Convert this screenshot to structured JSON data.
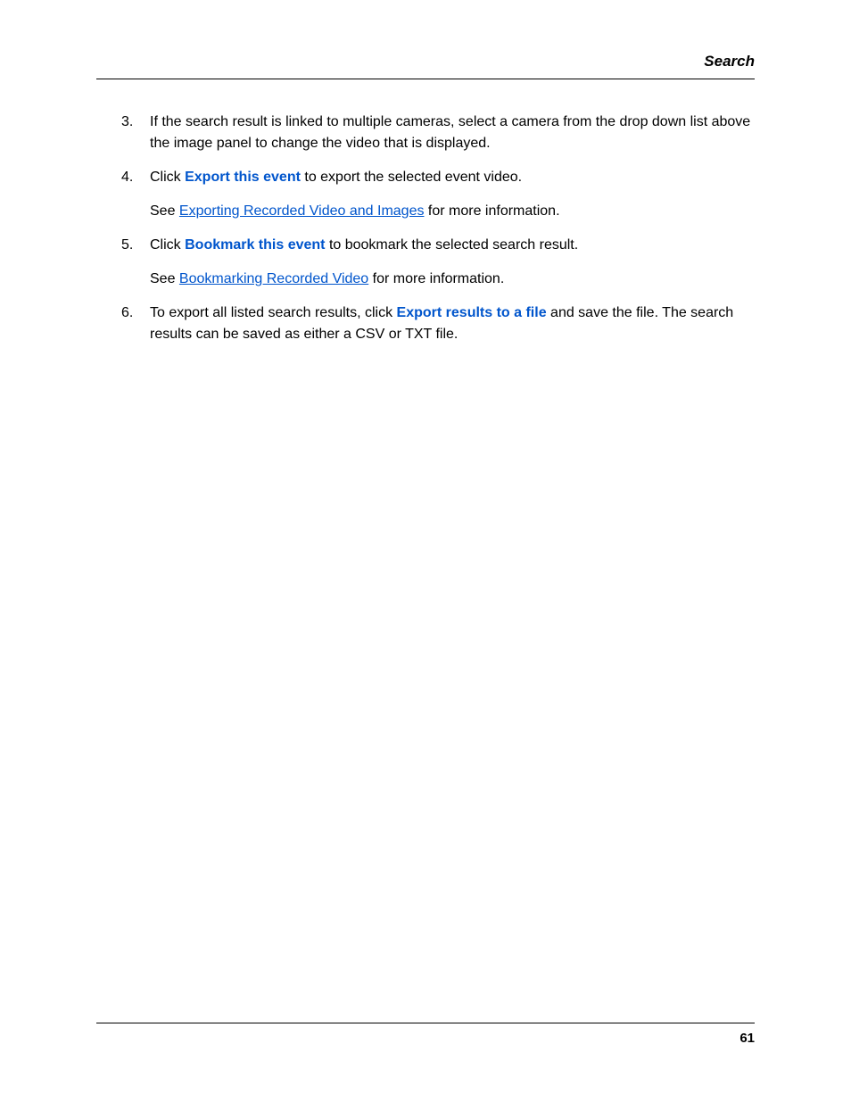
{
  "header": {
    "title": "Search"
  },
  "steps": {
    "s3": {
      "num": "3.",
      "text": "If the search result is linked to multiple cameras, select a camera from the drop down list above the image panel to change the video that is displayed."
    },
    "s4": {
      "num": "4.",
      "pre": "Click ",
      "bold": "Export this event",
      "post": " to export the selected event video.",
      "see_pre": "See ",
      "see_link": "Exporting Recorded Video and Images",
      "see_post": " for more information."
    },
    "s5": {
      "num": "5.",
      "pre": "Click ",
      "bold": "Bookmark this event",
      "post": " to bookmark the selected search result.",
      "see_pre": "See ",
      "see_link": "Bookmarking Recorded Video",
      "see_post": " for more information."
    },
    "s6": {
      "num": "6.",
      "pre": "To export all listed search results, click ",
      "bold": "Export results to a file",
      "post": " and save the file. The search results can be saved as either a CSV or TXT file."
    }
  },
  "footer": {
    "page_number": "61"
  }
}
